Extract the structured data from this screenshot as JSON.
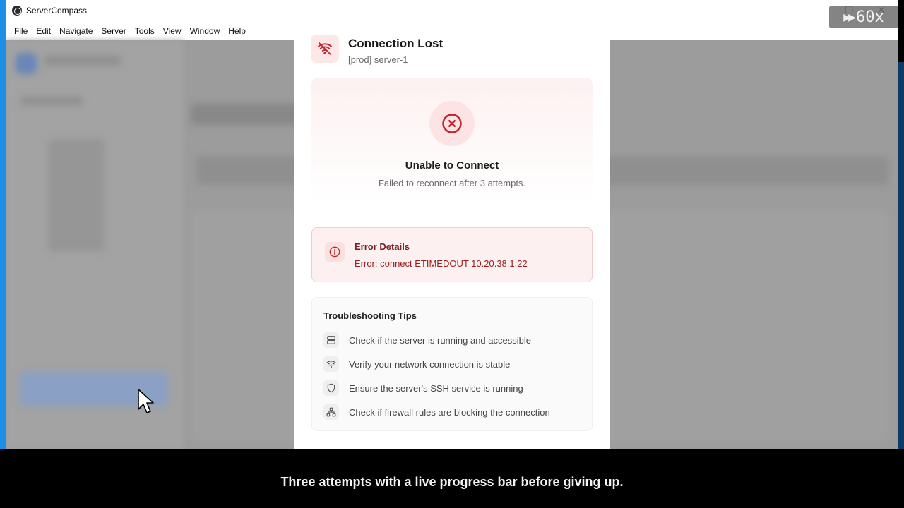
{
  "window": {
    "title": "ServerCompass",
    "controls": {
      "minimize": "–",
      "maximize": "☐",
      "close": "✕"
    }
  },
  "overlay_badge": {
    "icon": "fast-forward-icon",
    "label": "60x"
  },
  "menubar": {
    "items": [
      "File",
      "Edit",
      "Navigate",
      "Server",
      "Tools",
      "View",
      "Window",
      "Help"
    ]
  },
  "modal": {
    "header": {
      "icon": "wifi-off-icon",
      "title": "Connection Lost",
      "subtitle": "[prod] server-1"
    },
    "status": {
      "icon": "x-circle-icon",
      "title": "Unable to Connect",
      "subtitle": "Failed to reconnect after 3 attempts."
    },
    "error": {
      "icon": "alert-circle-icon",
      "title": "Error Details",
      "message": "Error: connect ETIMEDOUT 10.20.38.1:22"
    },
    "tips": {
      "title": "Troubleshooting Tips",
      "items": [
        {
          "icon": "server-icon",
          "text": "Check if the server is running and accessible"
        },
        {
          "icon": "wifi-icon",
          "text": "Verify your network connection is stable"
        },
        {
          "icon": "shield-icon",
          "text": "Ensure the server's SSH service is running"
        },
        {
          "icon": "network-icon",
          "text": "Check if firewall rules are blocking the connection"
        }
      ]
    }
  },
  "caption": {
    "text": "Three attempts with a live progress bar before giving up."
  },
  "colors": {
    "accent_red": "#c0262d",
    "error_bg": "#fdf0f0",
    "desktop_blue": "#1e8fe6"
  }
}
